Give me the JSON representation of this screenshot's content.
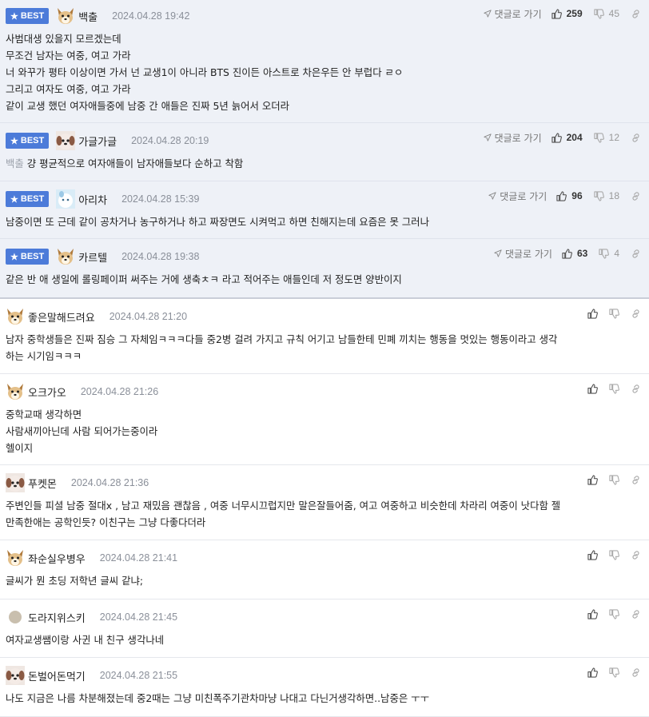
{
  "ui": {
    "best_label": "BEST",
    "reply_label": "댓글로 가기"
  },
  "best_comments": [
    {
      "nickname": "백출",
      "date": "2024.04.28 19:42",
      "up": "259",
      "down": "45",
      "lines": [
        "사범대생 있을지 모르겠는데",
        "무조건 남자는 여중, 여고 가라",
        "너 와꾸가 평타 이상이면 가서 넌 교생1이 아니라 BTS 진이든 아스트로 차은우든 안 부럽다 ㄹㅇ",
        "그리고 여자도 여중, 여고 가라",
        "같이 교생 했던 여자애들중에 남중 간 애들은 진짜 5년 늙어서 오더라"
      ]
    },
    {
      "nickname": "가글가글",
      "date": "2024.04.28 20:19",
      "up": "204",
      "down": "12",
      "mention": "백출",
      "lines": [
        "걍 평균적으로 여자애들이 남자애들보다 순하고 착함"
      ]
    },
    {
      "nickname": "아리차",
      "date": "2024.04.28 15:39",
      "up": "96",
      "down": "18",
      "lines": [
        "남중이면 또 근데 같이 공차거나 농구하거나 하고 짜장면도 시켜먹고 하면 친해지는데 요즘은 못 그러나"
      ]
    },
    {
      "nickname": "카르텔",
      "date": "2024.04.28 19:38",
      "up": "63",
      "down": "4",
      "lines": [
        "같은 반 애 생일에 롤링페이퍼 써주는 거에 생축ㅊㅋ 라고 적어주는 애들인데 저 정도면 양반이지"
      ]
    }
  ],
  "comments": [
    {
      "nickname": "좋은말해드려요",
      "date": "2024.04.28 21:20",
      "lines": [
        "남자 중학생들은 진짜 짐승 그 자체임ㅋㅋㅋ다들 중2병 걸려 가지고 규칙 어기고 남들한테 민폐 끼치는 행동을 멋있는 행동이라고 생각",
        "하는 시기임ㅋㅋㅋ"
      ]
    },
    {
      "nickname": "오크가오",
      "date": "2024.04.28 21:26",
      "lines": [
        "중학교때 생각하면",
        "사람새끼아닌데 사람 되어가는중이라",
        "헬이지"
      ]
    },
    {
      "nickname": "푸켓몬",
      "date": "2024.04.28 21:36",
      "lines": [
        "주변인들 피셜 남중 절대x , 남고 재밌음 괜찮음 , 여중 너무시끄럽지만 말은잘들어줌, 여고 여중하고 비슷한데 차라리 여중이 낫다함 젤",
        "만족한애는 공학인듯? 이친구는 그냥 다좋다더라"
      ]
    },
    {
      "nickname": "좌순실우병우",
      "date": "2024.04.28 21:41",
      "lines": [
        "글씨가 뭔 초딩 저학년 글씨 같냐;"
      ]
    },
    {
      "nickname": "도라지위스키",
      "date": "2024.04.28 21:45",
      "lines": [
        "여자교생쌤이랑 사귄 내 친구 생각나네"
      ]
    },
    {
      "nickname": "돈벌어돈먹기",
      "date": "2024.04.28 21:55",
      "lines": [
        "나도 지금은 나름 차분해졌는데 중2때는 그냥 미친폭주기관차마냥 나대고 다닌거생각하면..남중은 ㅜㅜ"
      ]
    }
  ]
}
